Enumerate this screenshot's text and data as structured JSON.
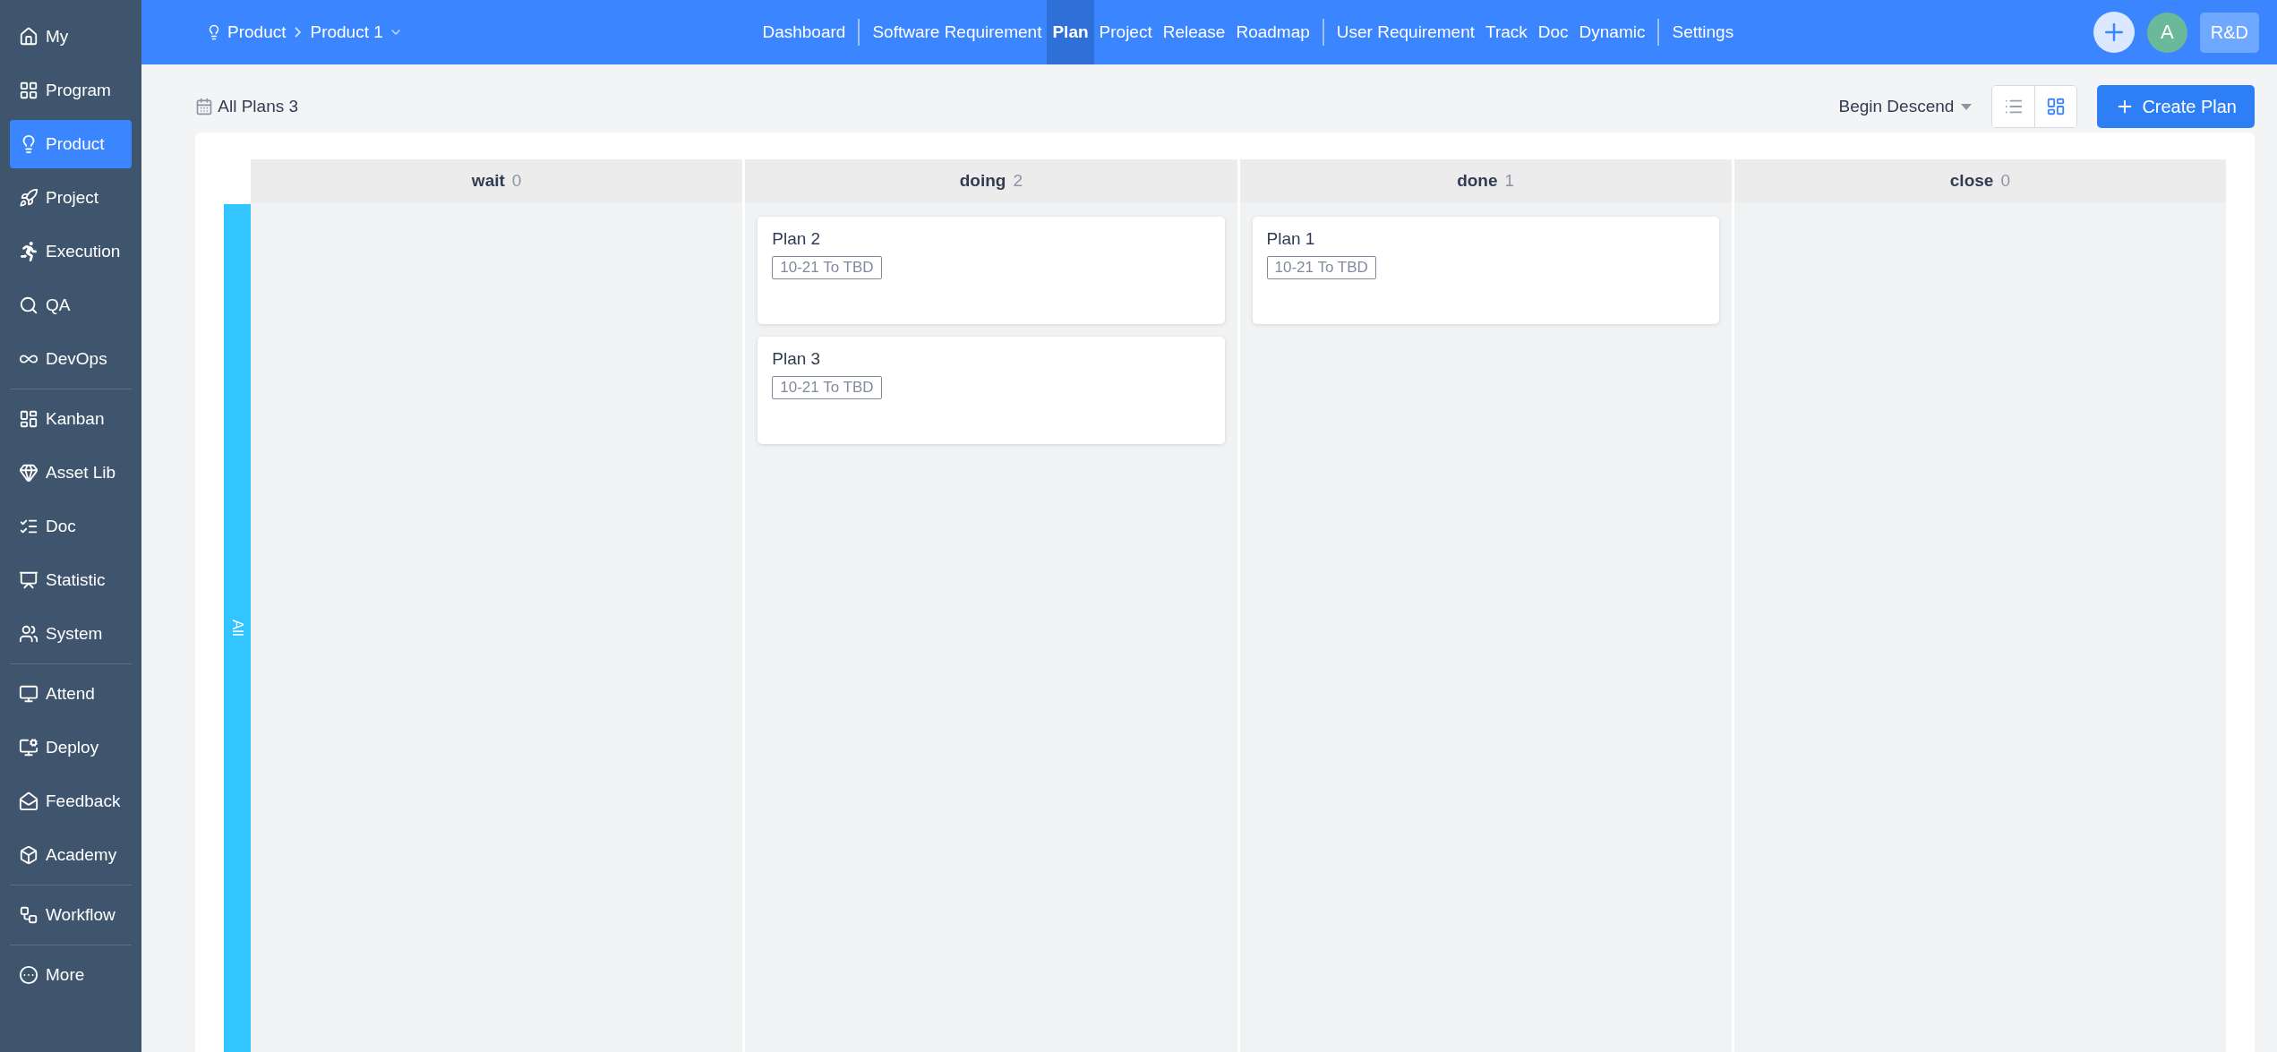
{
  "sidebar": {
    "groups": [
      [
        {
          "label": "My",
          "selected": false
        },
        {
          "label": "Program",
          "selected": false
        },
        {
          "label": "Product",
          "selected": true
        },
        {
          "label": "Project",
          "selected": false
        },
        {
          "label": "Execution",
          "selected": false
        },
        {
          "label": "QA",
          "selected": false
        },
        {
          "label": "DevOps",
          "selected": false
        }
      ],
      [
        {
          "label": "Kanban",
          "selected": false
        },
        {
          "label": "Asset Lib",
          "selected": false
        },
        {
          "label": "Doc",
          "selected": false
        },
        {
          "label": "Statistic",
          "selected": false
        },
        {
          "label": "System",
          "selected": false
        }
      ],
      [
        {
          "label": "Attend",
          "selected": false
        },
        {
          "label": "Deploy",
          "selected": false
        },
        {
          "label": "Feedback",
          "selected": false
        },
        {
          "label": "Academy",
          "selected": false
        }
      ],
      [
        {
          "label": "Workflow",
          "selected": false
        }
      ],
      [
        {
          "label": "More",
          "selected": false
        }
      ]
    ]
  },
  "header": {
    "breadcrumb": {
      "root": "Product",
      "current": "Product 1"
    },
    "nav_groups": [
      [
        {
          "label": "Dashboard",
          "selected": false
        }
      ],
      [
        {
          "label": "Software Requirement",
          "selected": false
        },
        {
          "label": "Plan",
          "selected": true
        },
        {
          "label": "Project",
          "selected": false
        },
        {
          "label": "Release",
          "selected": false
        },
        {
          "label": "Roadmap",
          "selected": false
        }
      ],
      [
        {
          "label": "User Requirement",
          "selected": false
        },
        {
          "label": "Track",
          "selected": false
        },
        {
          "label": "Doc",
          "selected": false
        },
        {
          "label": "Dynamic",
          "selected": false
        }
      ],
      [
        {
          "label": "Settings",
          "selected": false
        }
      ]
    ],
    "avatar": "A",
    "team": "R&D"
  },
  "toolbar": {
    "title": "All Plans",
    "count": "3",
    "sort": "Begin Descend",
    "view_toggle": [
      {
        "selected": false
      },
      {
        "selected": true
      }
    ],
    "create_button": "Create Plan"
  },
  "board": {
    "lane": "All",
    "columns": [
      {
        "name": "wait",
        "count": "0"
      },
      {
        "name": "doing",
        "count": "2",
        "cards": [
          {
            "title": "Plan 2",
            "date": "10-21 To TBD"
          },
          {
            "title": "Plan 3",
            "date": "10-21 To TBD"
          }
        ]
      },
      {
        "name": "done",
        "count": "1",
        "cards": [
          {
            "title": "Plan 1",
            "date": "10-21 To TBD"
          }
        ]
      },
      {
        "name": "close",
        "count": "0"
      }
    ]
  }
}
